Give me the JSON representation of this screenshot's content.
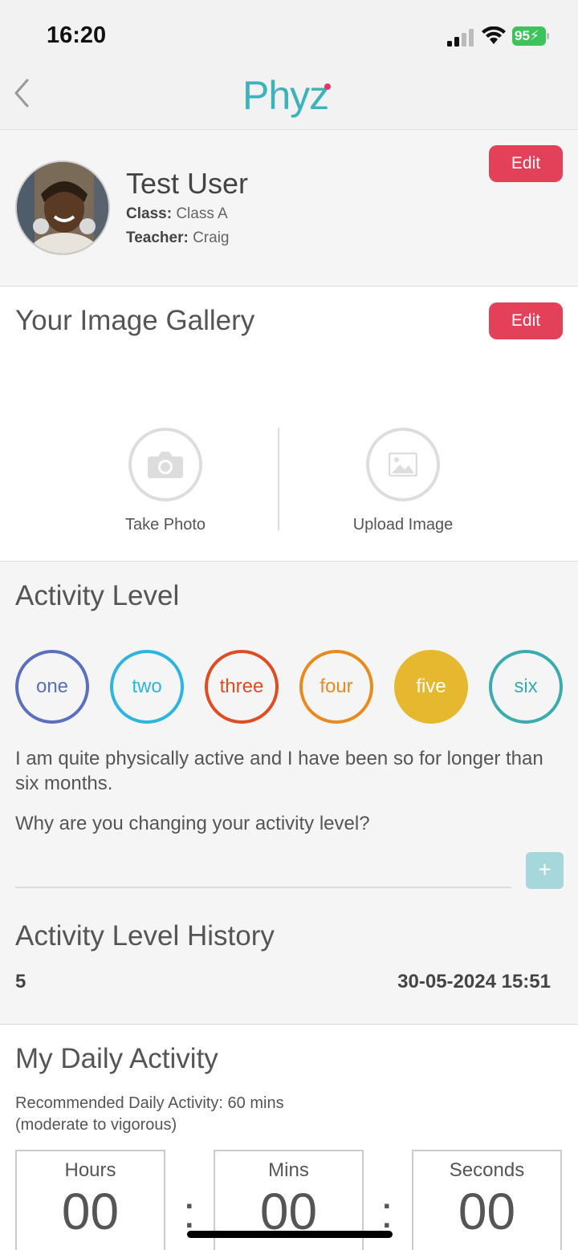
{
  "status": {
    "time": "16:20",
    "battery": "95"
  },
  "nav": {
    "logo": "Phyz"
  },
  "profile": {
    "name": "Test User",
    "class_label": "Class:",
    "class_value": "Class A",
    "teacher_label": "Teacher:",
    "teacher_value": "Craig",
    "edit_label": "Edit"
  },
  "gallery": {
    "title": "Your Image Gallery",
    "edit_label": "Edit",
    "take_photo": "Take Photo",
    "upload_image": "Upload Image"
  },
  "activity": {
    "title": "Activity Level",
    "levels": [
      {
        "label": "one",
        "color": "#5a6fc0",
        "selected": false
      },
      {
        "label": "two",
        "color": "#2bb5e0",
        "selected": false
      },
      {
        "label": "three",
        "color": "#e04b22",
        "selected": false
      },
      {
        "label": "four",
        "color": "#e88a1e",
        "selected": false
      },
      {
        "label": "five",
        "color": "#e5b830",
        "selected": true
      },
      {
        "label": "six",
        "color": "#3aabb0",
        "selected": false
      }
    ],
    "description": "I am quite physically active and I have been so for longer than six months.",
    "question": "Why are you changing your activity level?",
    "reason_value": "",
    "add_label": "+",
    "history_title": "Activity Level History",
    "history": [
      {
        "level": "5",
        "date": "30-05-2024 15:51"
      }
    ]
  },
  "daily": {
    "title": "My Daily Activity",
    "recommended_line1": "Recommended Daily Activity: 60 mins",
    "recommended_line2": "(moderate to vigorous)",
    "hours_label": "Hours",
    "hours_value": "00",
    "mins_label": "Mins",
    "mins_value": "00",
    "seconds_label": "Seconds",
    "seconds_value": "00",
    "separator": ":"
  }
}
